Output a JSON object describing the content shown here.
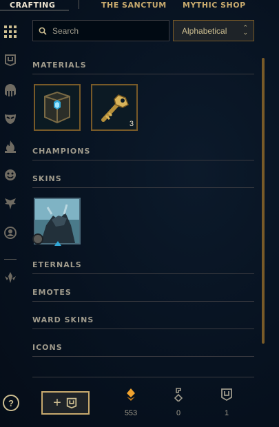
{
  "nav": {
    "tabs": [
      {
        "label": "CRAFTING"
      },
      {
        "label": "THE SANCTUM"
      },
      {
        "label": "MYTHIC SHOP"
      }
    ]
  },
  "rail": {
    "icons": [
      "grid-icon",
      "chest-icon",
      "champion-helmet-icon",
      "mask-icon",
      "ward-flame-icon",
      "emote-icon",
      "icon-bird-icon",
      "profile-icon",
      "eternals-icon"
    ]
  },
  "search": {
    "placeholder": "Search",
    "value": ""
  },
  "sort": {
    "selected": "Alphabetical"
  },
  "sections": {
    "materials": "MATERIALS",
    "champions": "CHAMPIONS",
    "skins": "SKINS",
    "eternals": "ETERNALS",
    "emotes": "EMOTES",
    "ward_skins": "WARD SKINS",
    "icons": "ICONS"
  },
  "materials": [
    {
      "name": "hextech-chest-icon",
      "count": ""
    },
    {
      "name": "hextech-key-icon",
      "count": "3"
    }
  ],
  "skins": [
    {
      "name": "champion-skin-shard"
    }
  ],
  "footer": {
    "help": "?",
    "add_button": "+",
    "currencies": [
      {
        "name": "orange-essence-icon",
        "value": "553"
      },
      {
        "name": "key-fragment-icon",
        "value": "0"
      },
      {
        "name": "chest-count-icon",
        "value": "1"
      }
    ]
  },
  "colors": {
    "gold": "#c8aa6e",
    "gold_dark": "#785a28",
    "text": "#a09b8c",
    "bg": "#071220",
    "essence": "#f0a32f"
  }
}
